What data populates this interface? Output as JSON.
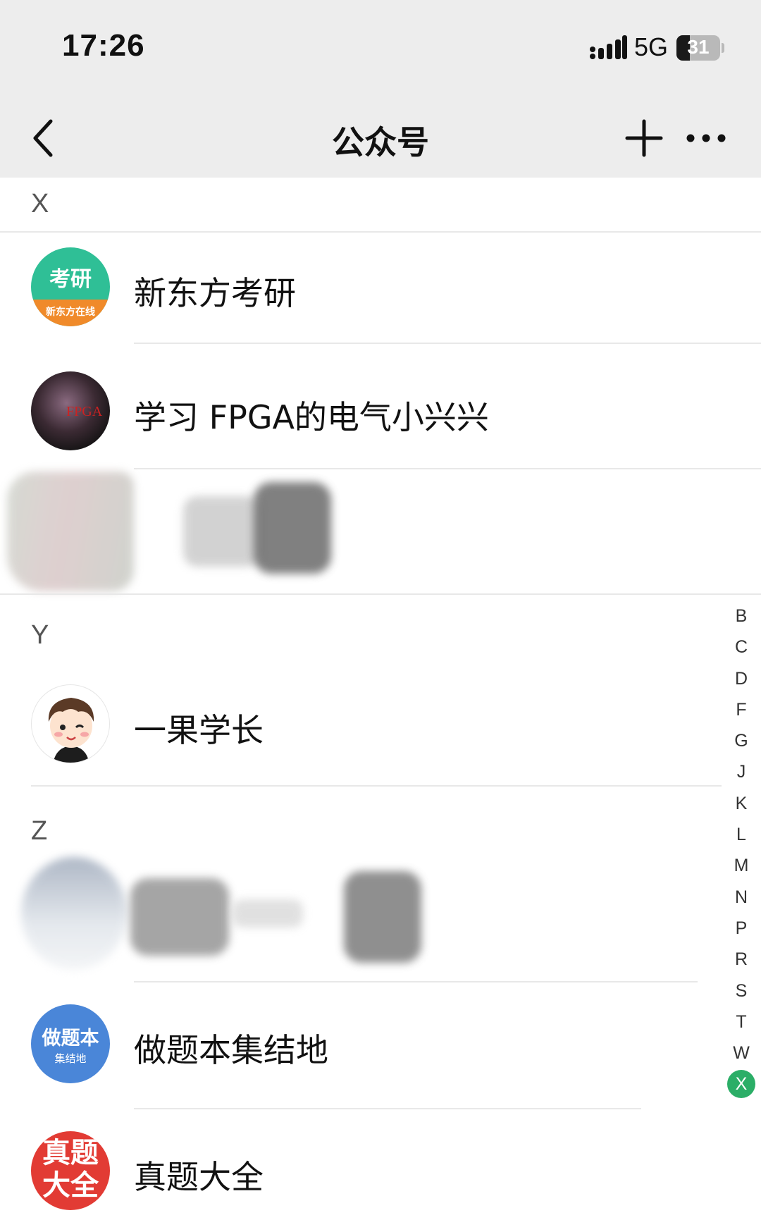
{
  "status_bar": {
    "time": "17:26",
    "network": "5G",
    "battery_level": "31"
  },
  "nav_bar": {
    "title": "公众号",
    "back_icon": "chevron-left-icon",
    "add_icon": "plus-icon",
    "more_icon": "ellipsis-icon"
  },
  "sections": [
    {
      "letter": "X",
      "items": [
        {
          "name": "新东方考研",
          "avatar_text": "考研",
          "avatar_sub": "新东方在线"
        },
        {
          "name": "学习 FPGA的电气小兴兴",
          "avatar_text": "FPGA"
        }
      ]
    },
    {
      "letter": "Y",
      "items": [
        {
          "name": "一果学长"
        }
      ]
    },
    {
      "letter": "Z",
      "items": [
        {
          "name": "做题本集结地",
          "avatar_text": "做题本",
          "avatar_sub": "集结地"
        },
        {
          "name": "真题大全",
          "avatar_text": "真题大全"
        }
      ]
    }
  ],
  "index_bar": {
    "letters": [
      "B",
      "C",
      "D",
      "F",
      "G",
      "J",
      "K",
      "L",
      "M",
      "N",
      "P",
      "R",
      "S",
      "T",
      "W",
      "X"
    ],
    "active": "X"
  },
  "colors": {
    "header_bg": "#ededed",
    "accent_green": "#2bae67"
  }
}
